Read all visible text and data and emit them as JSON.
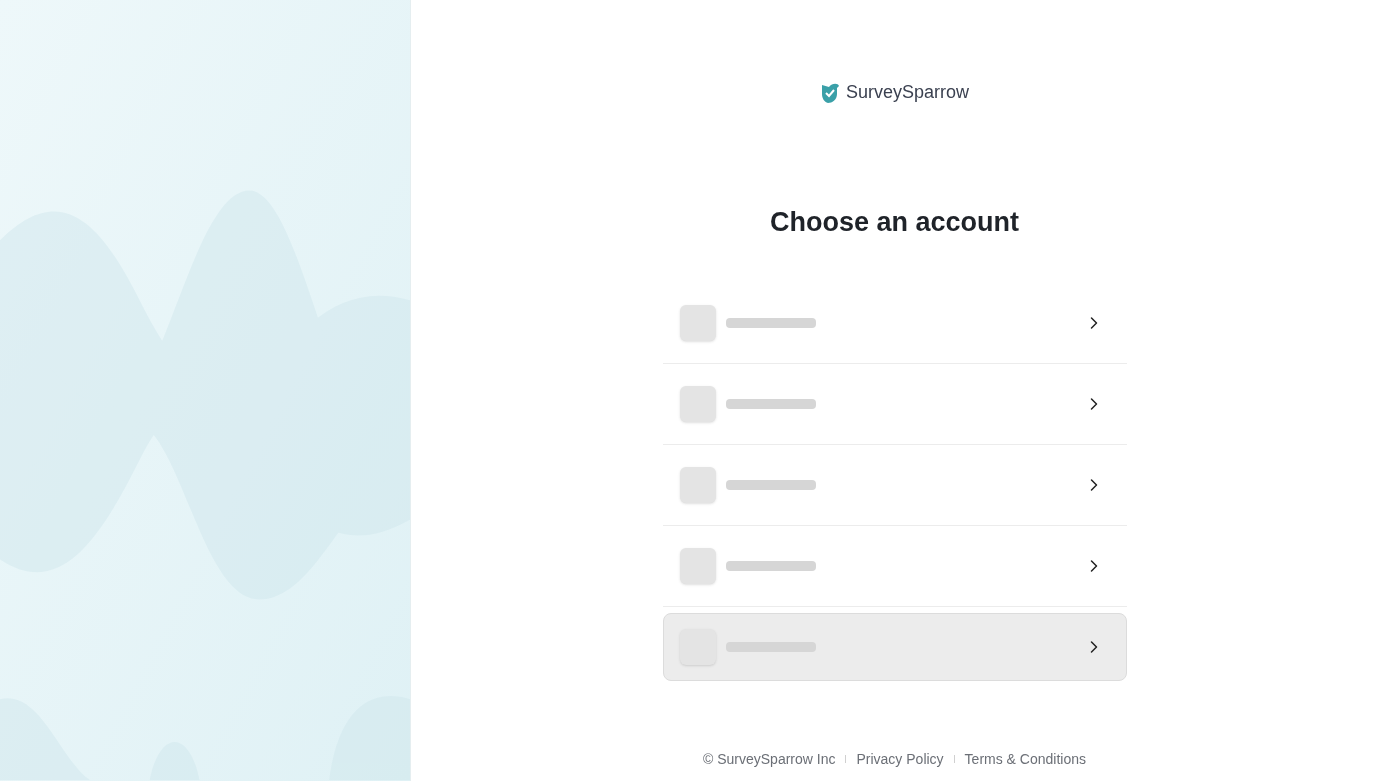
{
  "brand": {
    "name": "SurveySparrow"
  },
  "heading": "Choose an account",
  "accounts": [
    {
      "selected": false
    },
    {
      "selected": false
    },
    {
      "selected": false
    },
    {
      "selected": false
    },
    {
      "selected": true
    }
  ],
  "footer": {
    "copyright": "© SurveySparrow Inc",
    "links": [
      "Privacy Policy",
      "Terms & Conditions"
    ]
  }
}
